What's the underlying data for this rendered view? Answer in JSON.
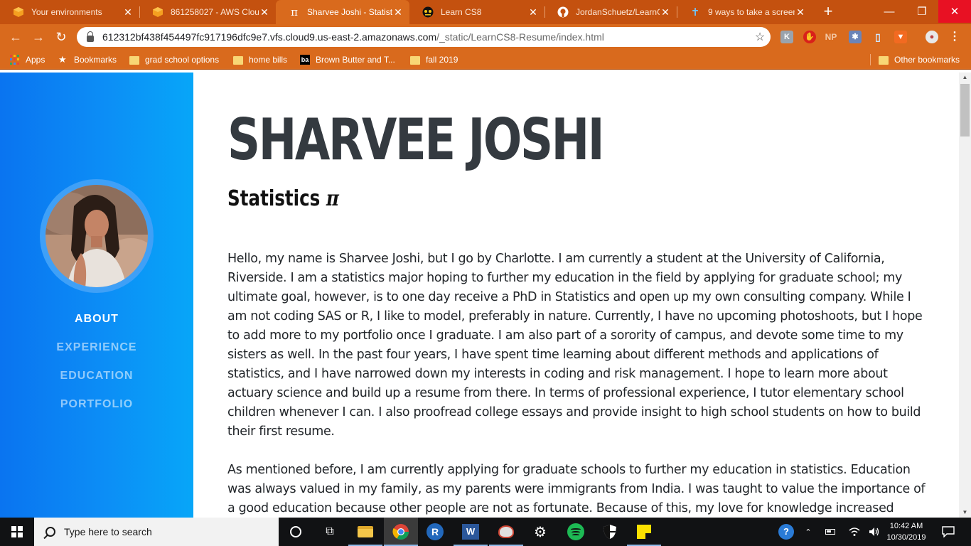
{
  "browser": {
    "tabs": [
      {
        "title": "Your environments",
        "icon": "aws-cube-icon"
      },
      {
        "title": "861258027 - AWS Clou",
        "icon": "aws-cube-icon"
      },
      {
        "title": "Sharvee Joshi - Statistic",
        "icon": "pi-icon"
      },
      {
        "title": "Learn CS8",
        "icon": "cs8-icon"
      },
      {
        "title": "JordanSchuetz/LearnCS",
        "icon": "github-icon"
      },
      {
        "title": "9 ways to take a screen",
        "icon": "pin-icon"
      }
    ],
    "address": {
      "host": "612312bf438f454497fc917196dfc9e7.vfs.cloud9.us-east-2.amazonaws.com",
      "path": "/_static/LearnCS8-Resume/index.html"
    },
    "extensions": [
      "K",
      "NP"
    ],
    "bookmarks": {
      "apps": "Apps",
      "bookmarks": "Bookmarks",
      "items": [
        "grad school options",
        "home bills",
        "Brown Butter and T...",
        "fall 2019"
      ],
      "other": "Other bookmarks"
    }
  },
  "page": {
    "name": "SHARVEE JOSHI",
    "subtitle": "Statistics",
    "subtitle_symbol": "π",
    "nav": [
      {
        "label": "ABOUT",
        "active": true
      },
      {
        "label": "EXPERIENCE",
        "active": false
      },
      {
        "label": "EDUCATION",
        "active": false
      },
      {
        "label": "PORTFOLIO",
        "active": false
      }
    ],
    "paragraphs": [
      "Hello, my name is Sharvee Joshi, but I go by Charlotte. I am currently a student at the University of California, Riverside. I am a statistics major hoping to further my education in the field by applying for graduate school; my ultimate goal, however, is to one day receive a PhD in Statistics and open up my own consulting company. While I am not coding SAS or R, I like to model, preferably in nature. Currently, I have no upcoming photoshoots, but I hope to add more to my portfolio once I graduate. I am also part of a sorority of campus, and devote some time to my sisters as well. In the past four years, I have spent time learning about different methods and applications of statistics, and I have narrowed down my interests in coding and risk management. I hope to learn more about actuary science and build up a resume from there. In terms of professional experience, I tutor elementary school children whenever I can. I also proofread college essays and provide insight to high school students on how to build their first resume.",
      "As mentioned before, I am currently applying for graduate schools to further my education in statistics. Education was always valued in my family, as my parents were immigrants from India. I was taught to value the importance of a good education because other people are not as fortunate. Because of this, my love for knowledge increased"
    ],
    "colors": {
      "sidebar": "#0c8ef6",
      "heading": "#343a40"
    }
  },
  "taskbar": {
    "search_placeholder": "Type here to search",
    "time": "10:42 AM",
    "date": "10/30/2019"
  }
}
